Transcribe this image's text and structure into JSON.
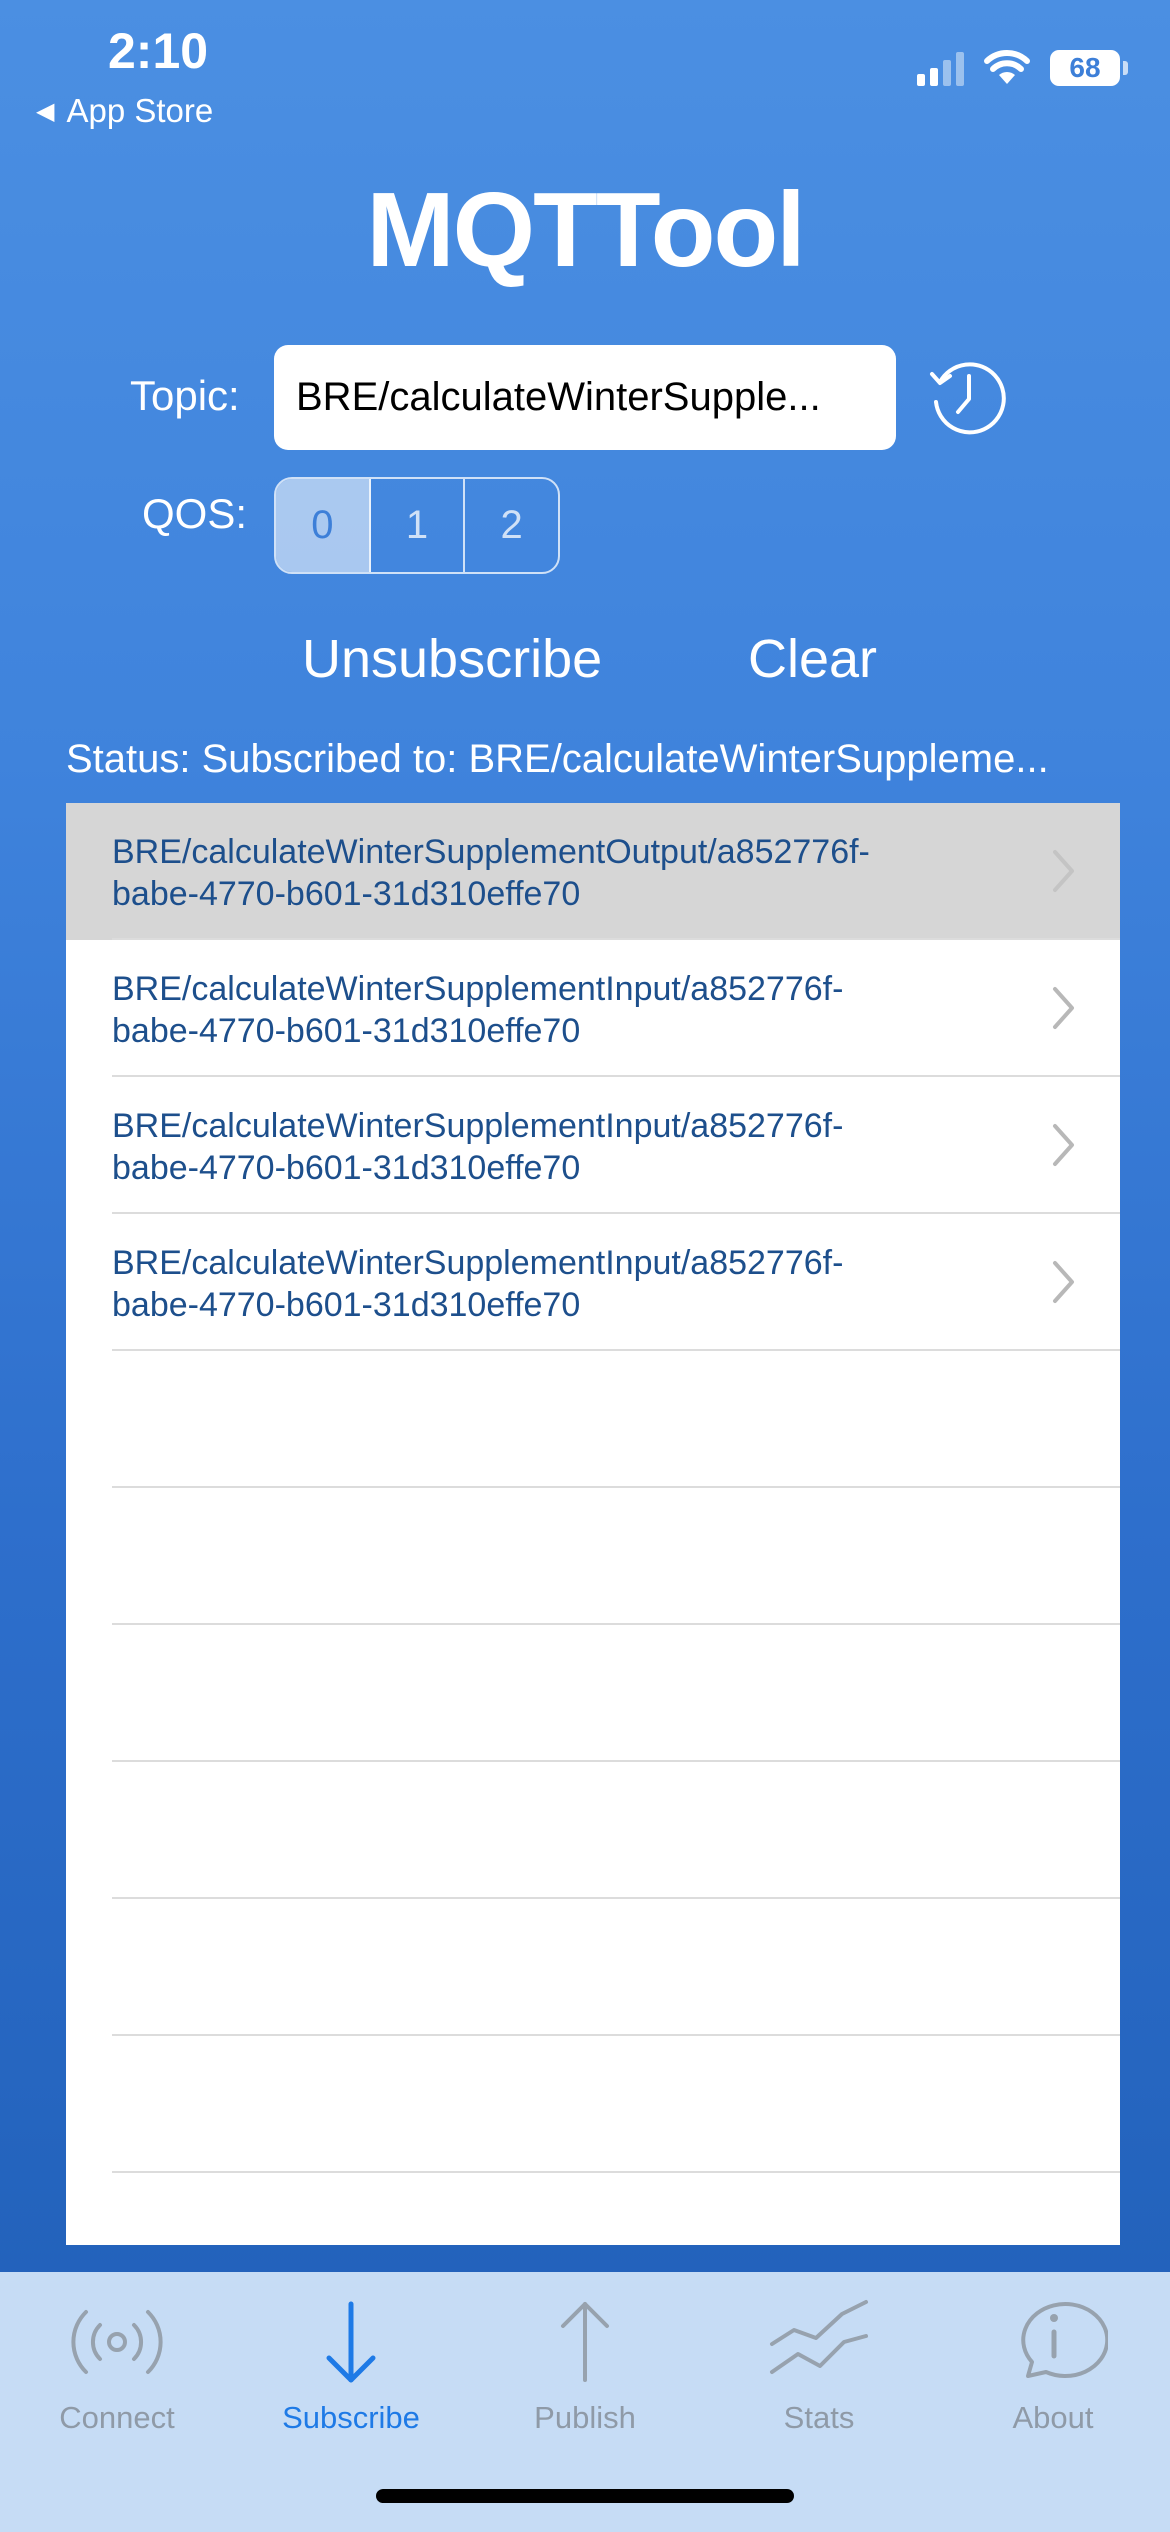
{
  "status_bar": {
    "time": "2:10",
    "back_label": "App Store",
    "battery": "68"
  },
  "app": {
    "title": "MQTTool"
  },
  "form": {
    "topic_label": "Topic:",
    "topic_value": "BRE/calculateWinterSupple...",
    "qos_label": "QOS:",
    "qos_options": [
      "0",
      "1",
      "2"
    ],
    "qos_selected": "0"
  },
  "actions": {
    "unsubscribe": "Unsubscribe",
    "clear": "Clear"
  },
  "status": {
    "text": "Status: Subscribed to: BRE/calculateWinterSuppleme..."
  },
  "messages": [
    {
      "line1": "BRE/calculateWinterSupplementOutput/a852776f-",
      "line2": "babe-4770-b601-31d310effe70",
      "selected": true
    },
    {
      "line1": "BRE/calculateWinterSupplementInput/a852776f-",
      "line2": "babe-4770-b601-31d310effe70",
      "selected": false
    },
    {
      "line1": "BRE/calculateWinterSupplementInput/a852776f-",
      "line2": "babe-4770-b601-31d310effe70",
      "selected": false
    },
    {
      "line1": "BRE/calculateWinterSupplementInput/a852776f-",
      "line2": "babe-4770-b601-31d310effe70",
      "selected": false
    }
  ],
  "tabs": [
    {
      "label": "Connect",
      "icon": "broadcast-icon",
      "active": false
    },
    {
      "label": "Subscribe",
      "icon": "arrow-down-icon",
      "active": true
    },
    {
      "label": "Publish",
      "icon": "arrow-up-icon",
      "active": false
    },
    {
      "label": "Stats",
      "icon": "chart-lines-icon",
      "active": false
    },
    {
      "label": "About",
      "icon": "info-bubble-icon",
      "active": false
    }
  ],
  "colors": {
    "accent": "#1e7ae6",
    "background_top": "#4b8fe2",
    "background_bottom": "#1f5eb6",
    "message_text": "#1d4f8c",
    "tab_inactive": "#8f9aa7",
    "tabbar_bg": "#c6dcf5"
  }
}
